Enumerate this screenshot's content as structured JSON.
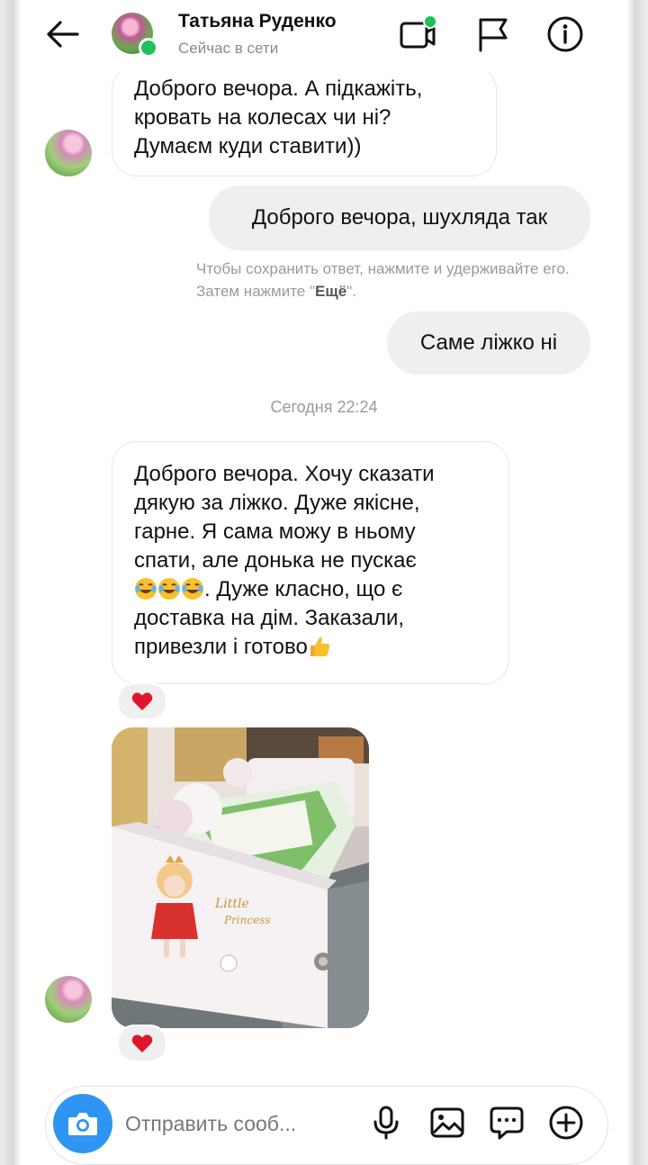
{
  "header": {
    "name": "Татьяна Руденко",
    "status": "Сейчас в сети"
  },
  "messages": {
    "m1": [
      "Доброго вечора. А підкажіть,",
      "кровать на колесах чи ні?",
      "Думаєм куди ставити))"
    ],
    "m2": "Доброго вечора, шухляда так",
    "hint_text": "Чтобы сохранить ответ, нажмите и удерживайте его. Затем нажмите \"",
    "hint_bold": "Ещё",
    "hint_end": "\".",
    "m3": "Саме ліжко ні",
    "timestamp": "Сегодня 22:24",
    "m4": [
      "Доброго вечора. Хочу сказати",
      "дякую за ліжко. Дуже якісне,",
      "гарне. Я сама можу в ньому",
      "спати, але донька не пускає",
      ". Дуже класно, що є",
      "доставка на дім. Заказали,",
      "привезли і готово"
    ]
  },
  "composer": {
    "placeholder": "Отправить сооб..."
  },
  "colors": {
    "accent": "#2f95f3",
    "online": "#1fc15a",
    "heart": "#e0142b",
    "outgoing_bubble": "#efefef"
  },
  "icons": [
    "back-arrow-icon",
    "video-call-icon",
    "flag-icon",
    "info-icon",
    "heart-icon",
    "camera-icon",
    "microphone-icon",
    "gallery-icon",
    "sticker-icon",
    "plus-icon",
    "laughing-emoji",
    "thumbs-up-emoji"
  ]
}
